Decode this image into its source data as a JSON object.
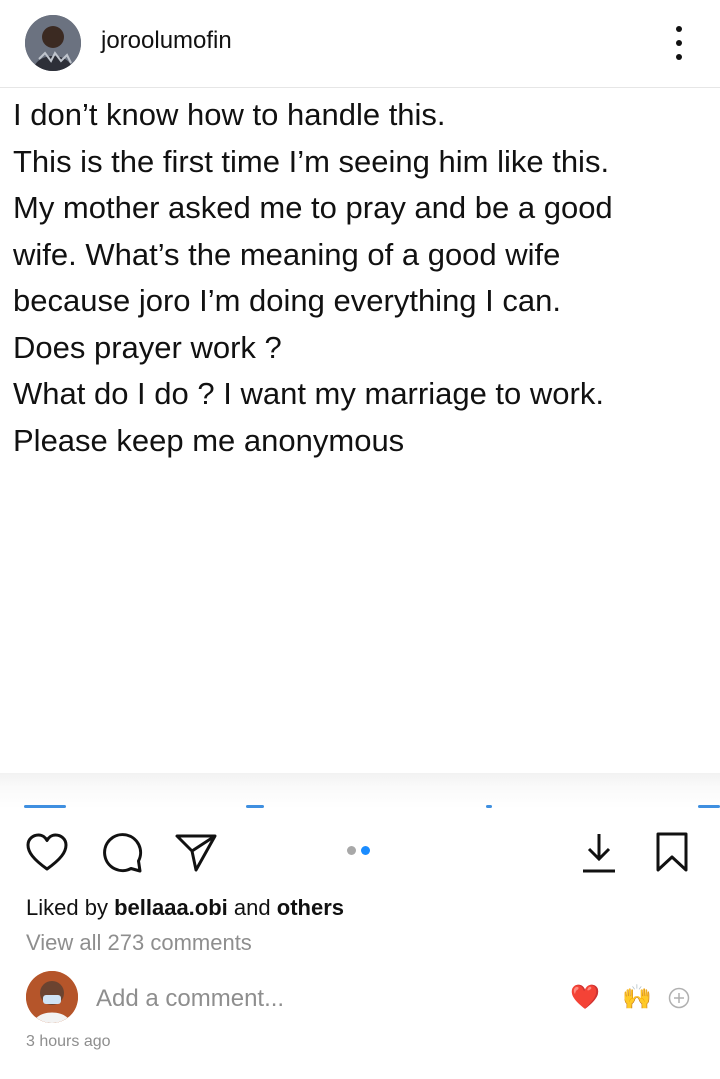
{
  "post": {
    "username": "joroolumofin",
    "text_lines": [
      "I don’t know how to handle this.",
      "This is the first time I’m seeing him like this.",
      "My mother asked me to pray and be a good",
      "wife. What’s the meaning of a good wife",
      "because joro I’m doing everything I can.",
      "Does prayer work ?",
      "What do I do ? I want my marriage to work.",
      "Please keep me anonymous"
    ]
  },
  "actions": {
    "like_icon": "heart-icon",
    "comment_icon": "comment-bubble-icon",
    "share_icon": "paper-plane-icon",
    "download_icon": "download-icon",
    "save_icon": "bookmark-icon"
  },
  "carousel": {
    "total": 2,
    "active_index": 1,
    "active_color": "#1a8cff",
    "inactive_color": "#a8a8a8"
  },
  "likes": {
    "prefix": "Liked by",
    "user": "bellaaa.obi",
    "joiner": "and",
    "suffix": "others"
  },
  "comments": {
    "view_all": "View all 273 comments",
    "placeholder": "Add a comment..."
  },
  "quick_reactions": [
    "❤️",
    "🙌"
  ],
  "timestamp": "3 hours ago"
}
